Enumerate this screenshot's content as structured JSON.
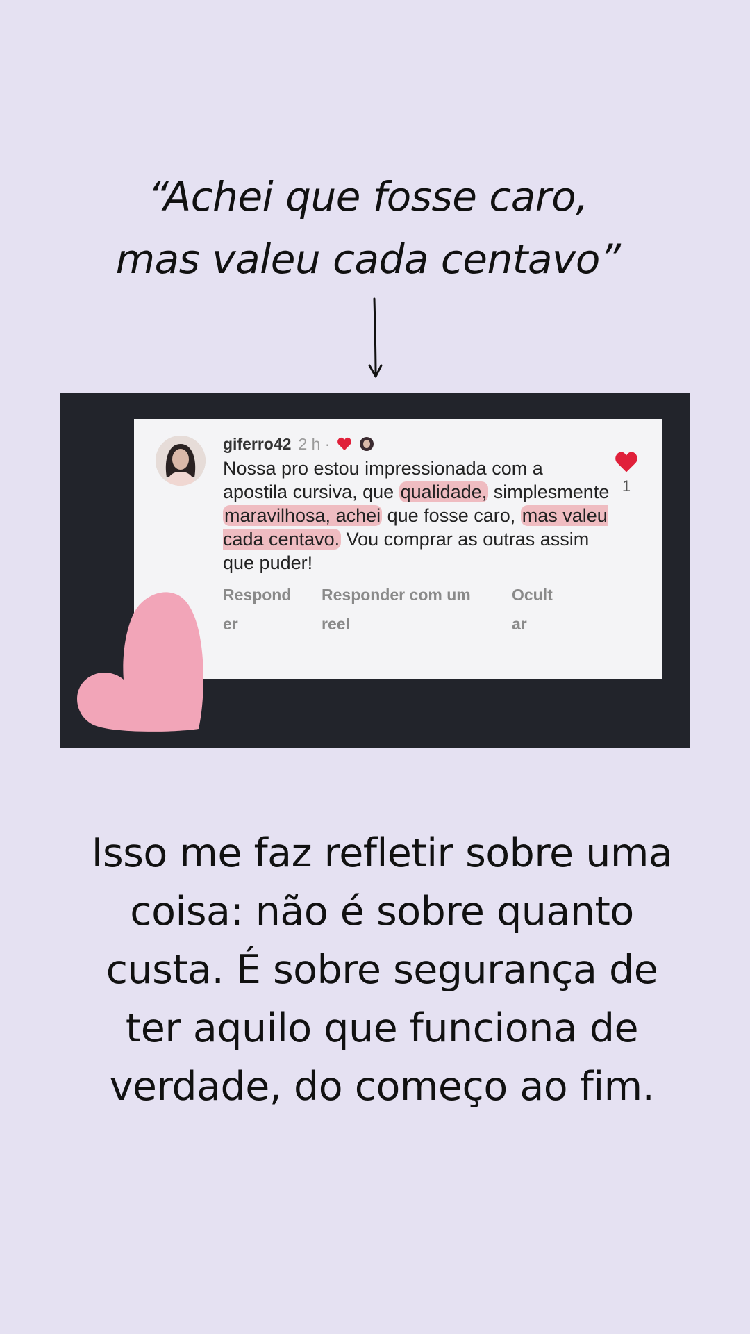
{
  "quote": {
    "line1": "“Achei que fosse caro,",
    "line2": "mas valeu cada centavo”"
  },
  "comment": {
    "username": "giferro42",
    "time": "2 h ·",
    "body": {
      "p1": "Nossa pro estou impressionada com a apostila cursiva, que ",
      "h1": "qualidade,",
      "p2": " simplesmente ",
      "h2": "maravilhosa, achei",
      "p3": " que fosse caro, ",
      "h3": "mas valeu cada centavo.",
      "p4": " Vou comprar as outras assim que puder!"
    },
    "actions": {
      "reply": "Respond er",
      "reply_reel": "Responder com um reel",
      "hide": "Ocult ar"
    },
    "like_count": "1",
    "like_color": "#e0203a"
  },
  "reflection": "Isso me faz refletir sobre uma coisa: não é sobre quanto custa. É sobre segurança de ter aquilo que funciona de verdade, do começo ao fim.",
  "colors": {
    "background": "#e5e1f2",
    "screenshot_frame": "#22242b",
    "highlight": "#e87880",
    "pink_heart": "#f2a5b8"
  }
}
